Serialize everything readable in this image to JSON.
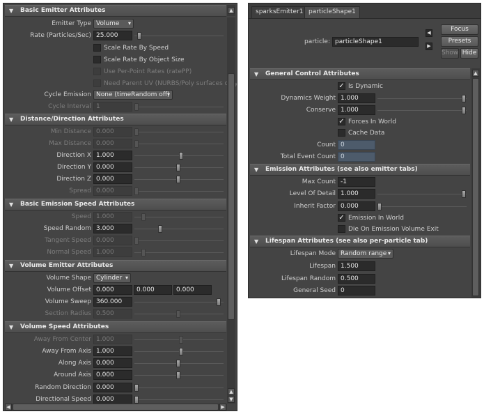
{
  "left": {
    "sections": {
      "basic_emitter": "Basic Emitter Attributes",
      "distance_direction": "Distance/Direction Attributes",
      "basic_emission_speed": "Basic Emission Speed Attributes",
      "volume_emitter": "Volume Emitter Attributes",
      "volume_speed": "Volume Speed Attributes"
    },
    "emitter_type": {
      "label": "Emitter Type",
      "value": "Volume"
    },
    "rate": {
      "label": "Rate (Particles/Sec)",
      "value": "25.000"
    },
    "checks": {
      "scale_rate_speed": "Scale Rate By Speed",
      "scale_rate_size": "Scale Rate By Object Size",
      "use_per_point": "Use Per-Point Rates (ratePP)",
      "need_parent_uv": "Need Parent UV (NURBS/Poly surfaces only)"
    },
    "cycle_emission": {
      "label": "Cycle Emission",
      "value": "None (timeRandom off)"
    },
    "cycle_interval": {
      "label": "Cycle Interval",
      "value": "1"
    },
    "min_distance": {
      "label": "Min Distance",
      "value": "0.000"
    },
    "max_distance": {
      "label": "Max Distance",
      "value": "0.000"
    },
    "direction_x": {
      "label": "Direction X",
      "value": "1.000"
    },
    "direction_y": {
      "label": "Direction Y",
      "value": "0.000"
    },
    "direction_z": {
      "label": "Direction Z",
      "value": "0.000"
    },
    "spread": {
      "label": "Spread",
      "value": "0.000"
    },
    "speed": {
      "label": "Speed",
      "value": "1.000"
    },
    "speed_random": {
      "label": "Speed Random",
      "value": "3.000"
    },
    "tangent_speed": {
      "label": "Tangent Speed",
      "value": "0.000"
    },
    "normal_speed": {
      "label": "Normal Speed",
      "value": "1.000"
    },
    "volume_shape": {
      "label": "Volume Shape",
      "value": "Cylinder"
    },
    "volume_offset": {
      "label": "Volume Offset",
      "x": "0.000",
      "y": "0.000",
      "z": "0.000"
    },
    "volume_sweep": {
      "label": "Volume Sweep",
      "value": "360.000"
    },
    "section_radius": {
      "label": "Section Radius",
      "value": "0.500"
    },
    "away_from_center": {
      "label": "Away From Center",
      "value": "1.000"
    },
    "away_from_axis": {
      "label": "Away From Axis",
      "value": "1.000"
    },
    "along_axis": {
      "label": "Along Axis",
      "value": "0.000"
    },
    "around_axis": {
      "label": "Around Axis",
      "value": "0.000"
    },
    "random_direction": {
      "label": "Random Direction",
      "value": "0.000"
    },
    "directional_speed": {
      "label": "Directional Speed",
      "value": "0.000"
    }
  },
  "right": {
    "tabs": [
      "sparksEmitter1",
      "particleShape1"
    ],
    "particle_label": "particle:",
    "particle_value": "particleShape1",
    "buttons": {
      "focus": "Focus",
      "presets": "Presets",
      "show": "Show",
      "hide": "Hide"
    },
    "sections": {
      "general_control": "General Control Attributes",
      "emission": "Emission Attributes (see also emitter tabs)",
      "lifespan": "Lifespan Attributes (see also per-particle tab)"
    },
    "is_dynamic": "Is Dynamic",
    "dynamics_weight": {
      "label": "Dynamics Weight",
      "value": "1.000"
    },
    "conserve": {
      "label": "Conserve",
      "value": "1.000"
    },
    "forces_in_world": "Forces In World",
    "cache_data": "Cache Data",
    "count": {
      "label": "Count",
      "value": "0"
    },
    "total_event_count": {
      "label": "Total Event Count",
      "value": "0"
    },
    "max_count": {
      "label": "Max Count",
      "value": "-1"
    },
    "level_of_detail": {
      "label": "Level Of Detail",
      "value": "1.000"
    },
    "inherit_factor": {
      "label": "Inherit Factor",
      "value": "0.000"
    },
    "emission_in_world": "Emission In World",
    "die_on_emission": "Die On Emission Volume Exit",
    "lifespan_mode": {
      "label": "Lifespan Mode",
      "value": "Random range"
    },
    "lifespan": {
      "label": "Lifespan",
      "value": "1.500"
    },
    "lifespan_random": {
      "label": "Lifespan Random",
      "value": "0.500"
    },
    "general_seed": {
      "label": "General Seed",
      "value": "0"
    }
  },
  "icons": {
    "collapse": "▼",
    "check": "✓",
    "dropdown": "▾",
    "scroll_up": "▲",
    "scroll_down": "▼",
    "scroll_left": "◀",
    "scroll_right": "▶"
  }
}
